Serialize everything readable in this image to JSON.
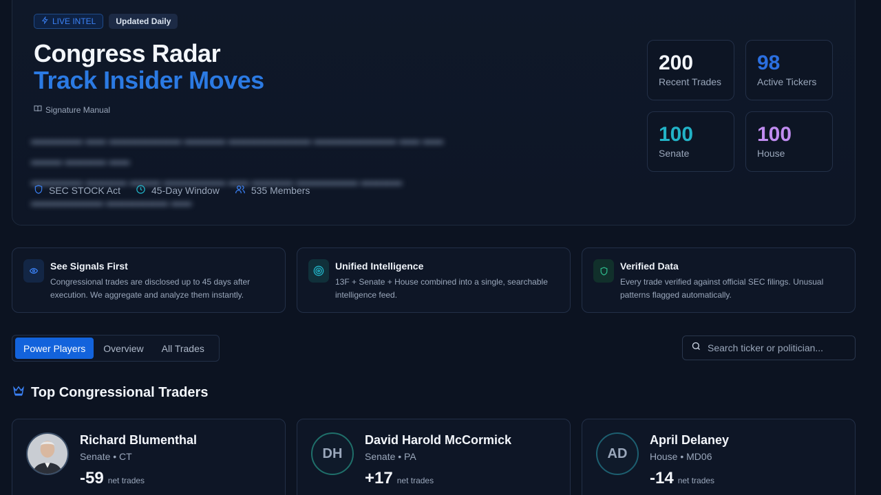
{
  "hero": {
    "badge_live": "LIVE INTEL",
    "badge_updated": "Updated Daily",
    "title": "Congress Radar",
    "subtitle": "Track Insider Moves",
    "manual_link": "Signature Manual",
    "meta": [
      "SEC STOCK Act",
      "45-Day Window",
      "535 Members"
    ]
  },
  "stats": [
    {
      "value": "200",
      "label": "Recent Trades",
      "color": "#f3f6fb"
    },
    {
      "value": "98",
      "label": "Active Tickers",
      "color": "#2b6fe0"
    },
    {
      "value": "100",
      "label": "Senate",
      "color": "#22b3c7"
    },
    {
      "value": "100",
      "label": "House",
      "color": "#c08cf0"
    }
  ],
  "features": [
    {
      "title": "See Signals First",
      "desc": "Congressional trades are disclosed up to 45 days after execution. We aggregate and analyze them instantly.",
      "icon": "eye-icon",
      "color": "#3b82f6"
    },
    {
      "title": "Unified Intelligence",
      "desc": "13F + Senate + House combined into a single, searchable intelligence feed.",
      "icon": "target-icon",
      "color": "#22b3c7"
    },
    {
      "title": "Verified Data",
      "desc": "Every trade verified against official SEC filings. Unusual patterns flagged automatically.",
      "icon": "shield-icon",
      "color": "#2fbf8f"
    }
  ],
  "tabs": [
    "Power Players",
    "Overview",
    "All Trades"
  ],
  "search": {
    "placeholder": "Search ticker or politician..."
  },
  "section": {
    "title": "Top Congressional Traders"
  },
  "traders": [
    {
      "name": "Richard Blumenthal",
      "chamber": "Senate • CT",
      "net": "-59",
      "net_label": "net trades",
      "initials": ""
    },
    {
      "name": "David Harold McCormick",
      "chamber": "Senate • PA",
      "net": "+17",
      "net_label": "net trades",
      "initials": "DH"
    },
    {
      "name": "April Delaney",
      "chamber": "House • MD06",
      "net": "-14",
      "net_label": "net trades",
      "initials": "AD"
    }
  ]
}
